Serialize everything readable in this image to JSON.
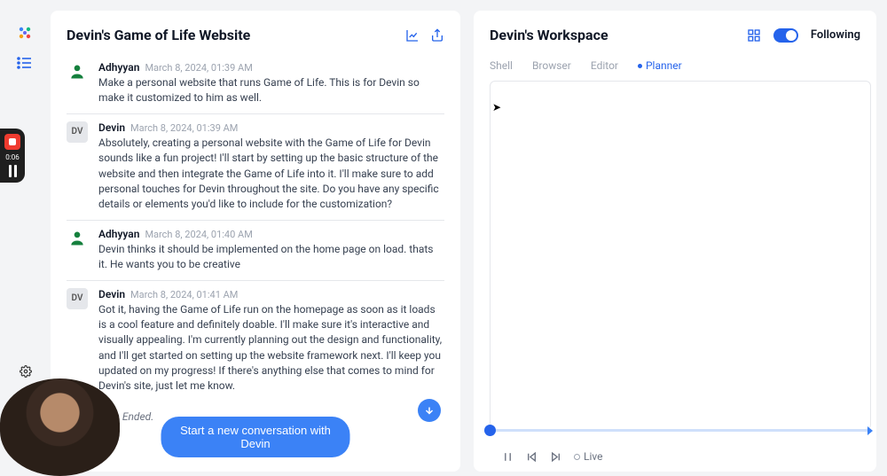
{
  "chat": {
    "title": "Devin's Game of Life Website",
    "session_ended": "sion Ended.",
    "new_conversation_label": "Start a new conversation with Devin",
    "messages": [
      {
        "author": "Adhyyan",
        "avatar": "adh",
        "ts": "March 8, 2024, 01:39 AM",
        "text": "Make a personal website that runs Game of Life. This is for Devin so make it customized to him as well."
      },
      {
        "author": "Devin",
        "avatar": "dv",
        "ts": "March 8, 2024, 01:39 AM",
        "text": "Absolutely, creating a personal website with the Game of Life for Devin sounds like a fun project! I'll start by setting up the basic structure of the website and then integrate the Game of Life into it. I'll make sure to add personal touches for Devin throughout the site. Do you have any specific details or elements you'd like to include for the customization?"
      },
      {
        "author": "Adhyyan",
        "avatar": "adh",
        "ts": "March 8, 2024, 01:40 AM",
        "text": "Devin thinks it should be implemented on the home page on load. thats it. He wants you to be creative"
      },
      {
        "author": "Devin",
        "avatar": "dv",
        "ts": "March 8, 2024, 01:41 AM",
        "text": "Got it, having the Game of Life run on the homepage as soon as it loads is a cool feature and definitely doable. I'll make sure it's interactive and visually appealing. I'm currently planning out the design and functionality, and I'll get started on setting up the website framework next. I'll keep you updated on my progress! If there's anything else that comes to mind for Devin's site, just let me know."
      }
    ]
  },
  "workspace": {
    "title": "Devin's Workspace",
    "following_label": "Following",
    "tabs": [
      {
        "label": "Shell",
        "active": false
      },
      {
        "label": "Browser",
        "active": false
      },
      {
        "label": "Editor",
        "active": false
      },
      {
        "label": "Planner",
        "active": true
      }
    ],
    "live_label": "Live"
  },
  "recorder": {
    "time": "0:06"
  }
}
